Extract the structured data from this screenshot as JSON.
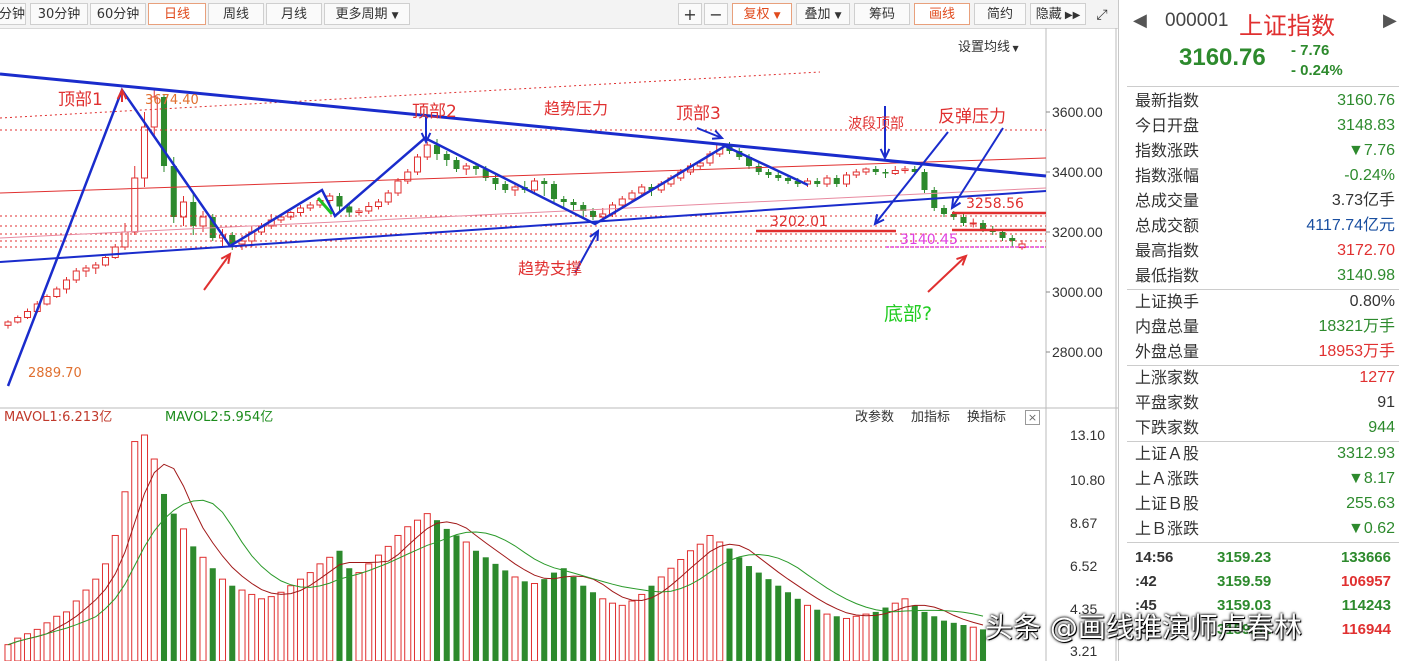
{
  "toolbar": {
    "buttons": [
      "分钟",
      "30分钟",
      "60分钟",
      "日线",
      "周线",
      "月线",
      "更多周期"
    ],
    "active": "日线",
    "right": {
      "plus": "+",
      "minus": "−",
      "fuquan": "复权",
      "diejia": "叠加",
      "chouma": "筹码",
      "huaxian": "画线",
      "jianyue": "简约",
      "yincang": "隐藏"
    }
  },
  "chart": {
    "set_ma_label": "设置均线",
    "price_axis": [
      "3600.00",
      "3400.00",
      "3200.00",
      "3000.00",
      "2800.00"
    ],
    "volume_axis": [
      "13.10",
      "10.80",
      "8.67",
      "6.52",
      "4.35",
      "3.21"
    ],
    "annotations": {
      "top1": "顶部1",
      "top2": "顶部2",
      "top3": "顶部3",
      "trend_pressure": "趋势压力",
      "trend_support": "趋势支撑",
      "wave_top": "波段顶部",
      "rebound_pressure": "反弹压力",
      "bottom": "底部?",
      "high_price": "3674.40",
      "low_price": "2889.70",
      "level1": "3202.01",
      "level2": "3258.56",
      "level3": "3140.45"
    },
    "mavol1": "MAVOL1:6.213亿",
    "mavol2": "MAVOL2:5.954亿",
    "vol_buttons": [
      "改参数",
      "加指标",
      "换指标"
    ],
    "close_icon": "×",
    "colors": {
      "up": "#e03030",
      "down": "#2d8a2d",
      "trend": "#1a2ccc"
    }
  },
  "chart_data": {
    "type": "candlestick",
    "ylim": [
      2700,
      3700
    ],
    "yticks": [
      3600,
      3400,
      3200,
      3000,
      2800
    ],
    "candles": [
      [
        2889,
        2900,
        2878,
        2906
      ],
      [
        2900,
        2915,
        2895,
        2922
      ],
      [
        2915,
        2935,
        2910,
        2945
      ],
      [
        2935,
        2960,
        2930,
        2970
      ],
      [
        2960,
        2985,
        2955,
        2992
      ],
      [
        2985,
        3010,
        2980,
        3018
      ],
      [
        3010,
        3040,
        2995,
        3050
      ],
      [
        3040,
        3070,
        3030,
        3080
      ],
      [
        3070,
        3080,
        3050,
        3090
      ],
      [
        3080,
        3090,
        3060,
        3100
      ],
      [
        3090,
        3115,
        3085,
        3120
      ],
      [
        3115,
        3150,
        3110,
        3160
      ],
      [
        3150,
        3200,
        3140,
        3230
      ],
      [
        3200,
        3380,
        3190,
        3420
      ],
      [
        3380,
        3550,
        3350,
        3600
      ],
      [
        3550,
        3650,
        3520,
        3674
      ],
      [
        3650,
        3420,
        3400,
        3660
      ],
      [
        3420,
        3250,
        3230,
        3450
      ],
      [
        3250,
        3300,
        3220,
        3320
      ],
      [
        3300,
        3220,
        3190,
        3330
      ],
      [
        3220,
        3250,
        3200,
        3270
      ],
      [
        3250,
        3180,
        3170,
        3260
      ],
      [
        3180,
        3190,
        3150,
        3210
      ],
      [
        3190,
        3160,
        3140,
        3200
      ],
      [
        3160,
        3170,
        3140,
        3190
      ],
      [
        3170,
        3200,
        3150,
        3220
      ],
      [
        3200,
        3220,
        3190,
        3230
      ],
      [
        3220,
        3240,
        3210,
        3260
      ],
      [
        3240,
        3250,
        3230,
        3260
      ],
      [
        3250,
        3265,
        3240,
        3270
      ],
      [
        3265,
        3280,
        3255,
        3290
      ],
      [
        3280,
        3290,
        3270,
        3300
      ],
      [
        3290,
        3305,
        3280,
        3310
      ],
      [
        3305,
        3320,
        3295,
        3330
      ],
      [
        3320,
        3285,
        3270,
        3330
      ],
      [
        3285,
        3265,
        3250,
        3295
      ],
      [
        3265,
        3270,
        3255,
        3280
      ],
      [
        3270,
        3285,
        3260,
        3300
      ],
      [
        3285,
        3300,
        3275,
        3310
      ],
      [
        3300,
        3330,
        3290,
        3340
      ],
      [
        3330,
        3370,
        3320,
        3380
      ],
      [
        3370,
        3400,
        3360,
        3410
      ],
      [
        3400,
        3450,
        3390,
        3460
      ],
      [
        3450,
        3490,
        3440,
        3500
      ],
      [
        3490,
        3460,
        3440,
        3510
      ],
      [
        3460,
        3440,
        3420,
        3470
      ],
      [
        3440,
        3410,
        3400,
        3450
      ],
      [
        3410,
        3420,
        3390,
        3430
      ],
      [
        3420,
        3410,
        3390,
        3430
      ],
      [
        3410,
        3380,
        3370,
        3420
      ],
      [
        3380,
        3360,
        3340,
        3390
      ],
      [
        3360,
        3340,
        3330,
        3370
      ],
      [
        3340,
        3350,
        3320,
        3360
      ],
      [
        3350,
        3340,
        3330,
        3370
      ],
      [
        3340,
        3370,
        3330,
        3380
      ],
      [
        3370,
        3360,
        3320,
        3380
      ],
      [
        3360,
        3310,
        3300,
        3370
      ],
      [
        3310,
        3300,
        3280,
        3320
      ],
      [
        3300,
        3290,
        3270,
        3310
      ],
      [
        3290,
        3270,
        3250,
        3300
      ],
      [
        3270,
        3250,
        3240,
        3280
      ],
      [
        3250,
        3260,
        3240,
        3280
      ],
      [
        3260,
        3290,
        3250,
        3300
      ],
      [
        3290,
        3310,
        3280,
        3320
      ],
      [
        3310,
        3330,
        3300,
        3340
      ],
      [
        3330,
        3350,
        3320,
        3360
      ],
      [
        3350,
        3340,
        3320,
        3360
      ],
      [
        3340,
        3360,
        3330,
        3370
      ],
      [
        3360,
        3380,
        3350,
        3390
      ],
      [
        3380,
        3400,
        3370,
        3410
      ],
      [
        3400,
        3420,
        3390,
        3430
      ],
      [
        3420,
        3430,
        3410,
        3440
      ],
      [
        3430,
        3460,
        3420,
        3470
      ],
      [
        3460,
        3490,
        3450,
        3495
      ],
      [
        3490,
        3470,
        3460,
        3500
      ],
      [
        3470,
        3450,
        3440,
        3480
      ],
      [
        3450,
        3420,
        3410,
        3460
      ],
      [
        3420,
        3400,
        3390,
        3430
      ],
      [
        3400,
        3390,
        3380,
        3410
      ],
      [
        3390,
        3380,
        3370,
        3400
      ],
      [
        3380,
        3370,
        3360,
        3390
      ],
      [
        3370,
        3360,
        3350,
        3380
      ],
      [
        3360,
        3370,
        3350,
        3380
      ],
      [
        3370,
        3360,
        3350,
        3380
      ],
      [
        3360,
        3380,
        3350,
        3390
      ],
      [
        3380,
        3360,
        3350,
        3390
      ],
      [
        3360,
        3390,
        3350,
        3400
      ],
      [
        3390,
        3400,
        3380,
        3410
      ],
      [
        3400,
        3410,
        3390,
        3415
      ],
      [
        3410,
        3400,
        3390,
        3420
      ],
      [
        3400,
        3395,
        3380,
        3410
      ],
      [
        3395,
        3405,
        3390,
        3420
      ],
      [
        3405,
        3410,
        3395,
        3420
      ],
      [
        3410,
        3400,
        3390,
        3420
      ],
      [
        3400,
        3340,
        3330,
        3410
      ],
      [
        3340,
        3280,
        3270,
        3350
      ],
      [
        3280,
        3260,
        3250,
        3290
      ],
      [
        3260,
        3250,
        3240,
        3270
      ],
      [
        3250,
        3230,
        3220,
        3260
      ],
      [
        3230,
        3230,
        3215,
        3245
      ],
      [
        3230,
        3210,
        3200,
        3240
      ],
      [
        3210,
        3200,
        3190,
        3220
      ],
      [
        3200,
        3180,
        3170,
        3210
      ],
      [
        3180,
        3170,
        3150,
        3190
      ],
      [
        3148,
        3160,
        3141,
        3173
      ]
    ],
    "volume": [
      3.5,
      3.8,
      4.0,
      4.2,
      4.5,
      4.8,
      5.0,
      5.5,
      6.0,
      6.5,
      7.2,
      8.5,
      10.5,
      12.8,
      13.1,
      12.0,
      10.4,
      9.5,
      8.8,
      8.0,
      7.5,
      7.0,
      6.5,
      6.2,
      6.0,
      5.8,
      5.6,
      5.7,
      5.9,
      6.2,
      6.5,
      6.8,
      7.2,
      7.5,
      7.8,
      7.0,
      6.8,
      7.2,
      7.6,
      8.0,
      8.5,
      8.9,
      9.2,
      9.5,
      9.2,
      8.8,
      8.5,
      8.2,
      7.8,
      7.5,
      7.2,
      6.9,
      6.6,
      6.4,
      6.3,
      6.5,
      6.8,
      7.0,
      6.6,
      6.2,
      5.9,
      5.6,
      5.4,
      5.3,
      5.5,
      5.8,
      6.2,
      6.6,
      7.0,
      7.4,
      7.8,
      8.1,
      8.5,
      8.2,
      7.9,
      7.5,
      7.1,
      6.8,
      6.5,
      6.2,
      5.9,
      5.6,
      5.3,
      5.1,
      4.9,
      4.8,
      4.7,
      4.8,
      4.9,
      5.0,
      5.2,
      5.4,
      5.6,
      5.3,
      5.0,
      4.8,
      4.6,
      4.5,
      4.4,
      4.3,
      4.2
    ],
    "vol_ylim": [
      3.21,
      13.1
    ]
  },
  "panel": {
    "code": "000001",
    "name": "上证指数",
    "price": "3160.76",
    "change": "- 7.76",
    "change_pct": "- 0.24%",
    "rows1": [
      {
        "label": "最新指数",
        "value": "3160.76",
        "color": "#2d8a2d"
      },
      {
        "label": "今日开盘",
        "value": "3148.83",
        "color": "#2d8a2d"
      },
      {
        "label": "指数涨跌",
        "value": "▼7.76",
        "color": "#2d8a2d"
      },
      {
        "label": "指数涨幅",
        "value": "-0.24%",
        "color": "#2d8a2d"
      },
      {
        "label": "总成交量",
        "value": "3.73亿手",
        "color": "#333"
      },
      {
        "label": "总成交额",
        "value": "4117.74亿元",
        "color": "#1a4fa0"
      },
      {
        "label": "最高指数",
        "value": "3172.70",
        "color": "#e03030"
      },
      {
        "label": "最低指数",
        "value": "3140.98",
        "color": "#2d8a2d"
      }
    ],
    "rows2": [
      {
        "label": "上证换手",
        "value": "0.80%",
        "color": "#333"
      },
      {
        "label": "内盘总量",
        "value": "18321万手",
        "color": "#2d8a2d"
      },
      {
        "label": "外盘总量",
        "value": "18953万手",
        "color": "#e03030"
      }
    ],
    "rows3": [
      {
        "label": "上涨家数",
        "value": "1277",
        "color": "#e03030"
      },
      {
        "label": "平盘家数",
        "value": "91",
        "color": "#333"
      },
      {
        "label": "下跌家数",
        "value": "944",
        "color": "#2d8a2d"
      }
    ],
    "rows4": [
      {
        "label": "上证Ａ股",
        "value": "3312.93",
        "color": "#2d8a2d"
      },
      {
        "label": "上Ａ涨跌",
        "value": "▼8.17",
        "color": "#2d8a2d"
      },
      {
        "label": "上证Ｂ股",
        "value": "255.63",
        "color": "#2d8a2d"
      },
      {
        "label": "上Ｂ涨跌",
        "value": "▼0.62",
        "color": "#2d8a2d"
      }
    ],
    "ticks": [
      {
        "time": "14:56",
        "price": "3159.23",
        "vol": "133666",
        "vcolor": "#2d8a2d"
      },
      {
        "time": ":42",
        "price": "3159.59",
        "vol": "106957",
        "vcolor": "#e03030"
      },
      {
        "time": ":45",
        "price": "3159.03",
        "vol": "114243",
        "vcolor": "#2d8a2d"
      },
      {
        "time": ":51",
        "price": "3159.31",
        "vol": "116944",
        "vcolor": "#e03030"
      }
    ]
  },
  "watermark": "头条 @画线推演师卢春林"
}
